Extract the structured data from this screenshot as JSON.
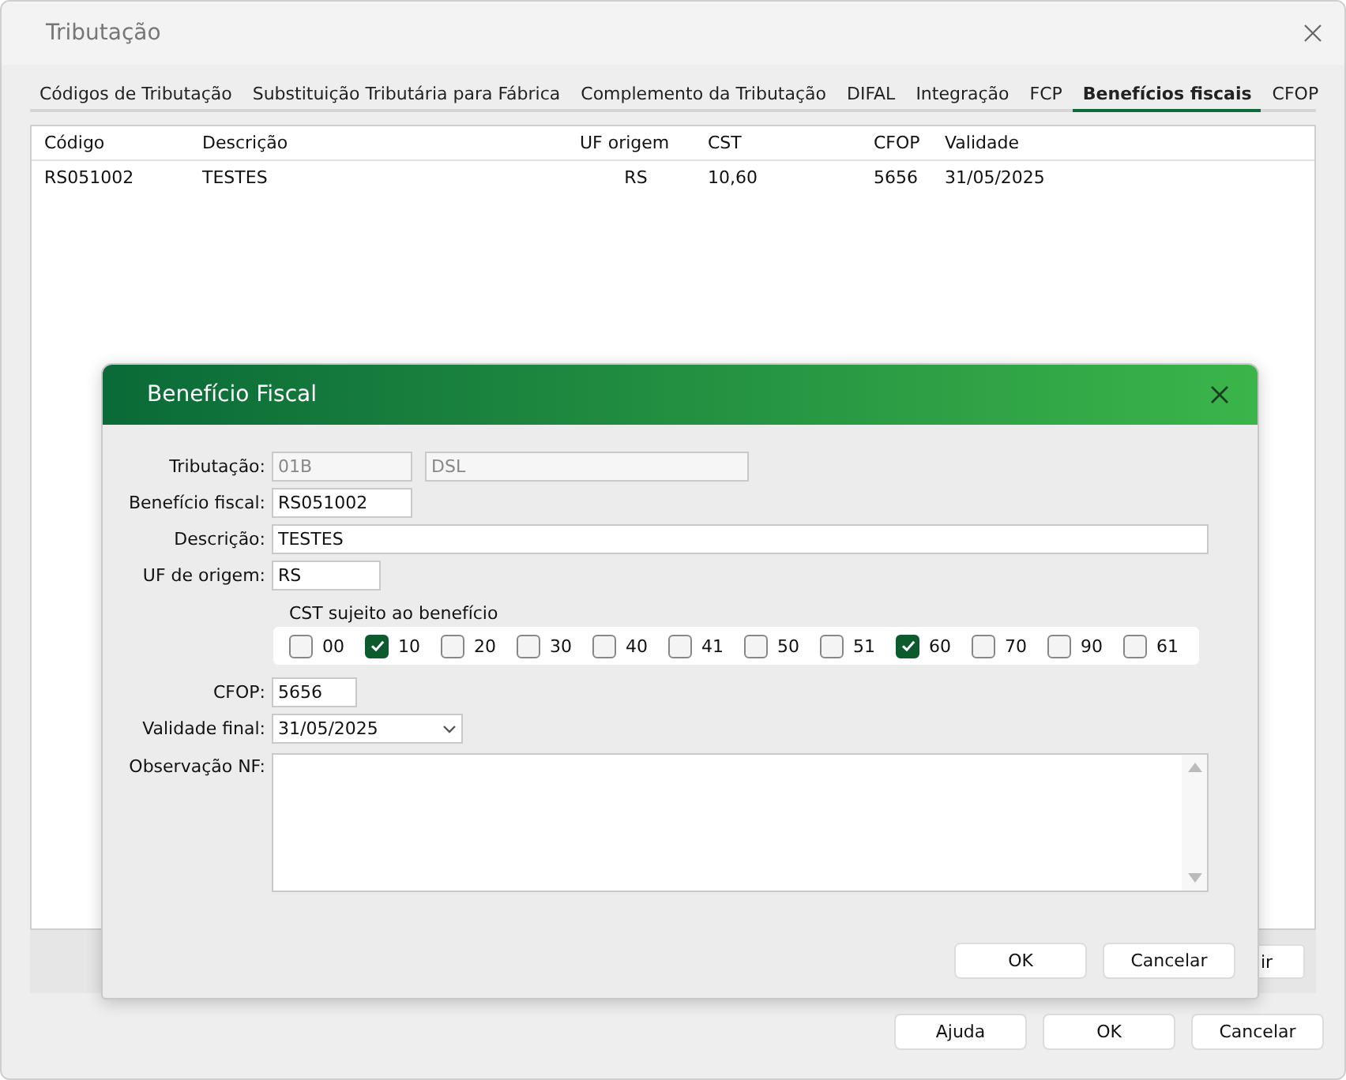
{
  "window": {
    "title": "Tributação"
  },
  "tabs": [
    {
      "label": "Códigos de Tributação",
      "selected": false
    },
    {
      "label": "Substituição Tributária para Fábrica",
      "selected": false
    },
    {
      "label": "Complemento da Tributação",
      "selected": false
    },
    {
      "label": "DIFAL",
      "selected": false
    },
    {
      "label": "Integração",
      "selected": false
    },
    {
      "label": "FCP",
      "selected": false
    },
    {
      "label": "Benefícios fiscais",
      "selected": true
    },
    {
      "label": "CFOP",
      "selected": false
    }
  ],
  "table": {
    "columns": [
      "Código",
      "Descrição",
      "UF origem",
      "CST",
      "CFOP",
      "Validade"
    ],
    "rows": [
      [
        "RS051002",
        "TESTES",
        "RS",
        "10,60",
        "5656",
        "31/05/2025"
      ]
    ]
  },
  "hidden_button": "ir",
  "buttons": [
    "Ajuda",
    "OK",
    "Cancelar"
  ],
  "dialog": {
    "title": "Benefício Fiscal",
    "fields": [
      {
        "kind": "pair",
        "label": "Tributação:",
        "values": [
          "01B",
          "DSL"
        ],
        "disabled": true
      },
      {
        "kind": "text",
        "label": "Benefício fiscal:",
        "value": "RS051002",
        "disabled": false
      },
      {
        "kind": "text",
        "label": "Descrição:",
        "value": "TESTES",
        "disabled": false
      },
      {
        "kind": "text",
        "label": "UF de origem:",
        "value": "RS",
        "disabled": false
      },
      {
        "kind": "checks",
        "label": "CST sujeito ao benefício",
        "options": [
          {
            "label": "00",
            "checked": false
          },
          {
            "label": "10",
            "checked": true
          },
          {
            "label": "20",
            "checked": false
          },
          {
            "label": "30",
            "checked": false
          },
          {
            "label": "40",
            "checked": false
          },
          {
            "label": "41",
            "checked": false
          },
          {
            "label": "50",
            "checked": false
          },
          {
            "label": "51",
            "checked": false
          },
          {
            "label": "60",
            "checked": true
          },
          {
            "label": "70",
            "checked": false
          },
          {
            "label": "90",
            "checked": false
          },
          {
            "label": "61",
            "checked": false
          }
        ]
      },
      {
        "kind": "text",
        "label": "CFOP:",
        "value": "5656",
        "disabled": false
      },
      {
        "kind": "select",
        "label": "Validade final:",
        "value": "31/05/2025"
      },
      {
        "kind": "textarea",
        "label": "Observação NF:"
      }
    ],
    "buttons": [
      "OK",
      "Cancelar"
    ]
  }
}
